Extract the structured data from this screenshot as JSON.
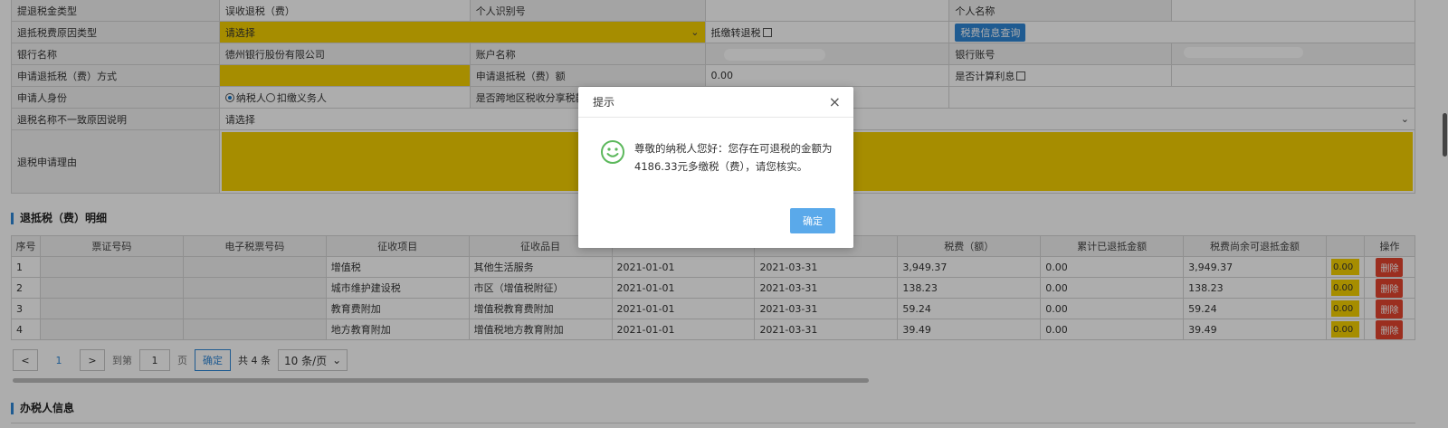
{
  "form": {
    "r1": {
      "l1": "提退税金类型",
      "v1": "误收退税（费）",
      "l2": "个人识别号",
      "l3": "个人名称"
    },
    "r2": {
      "l1": "退抵税费原因类型",
      "v1": "请选择",
      "l2": "抵缴转退税",
      "btn": "税费信息查询"
    },
    "r3": {
      "l1": "银行名称",
      "v1": "德州银行股份有限公司",
      "l2": "账户名称",
      "l3": "银行账号"
    },
    "r4": {
      "l1": "申请退抵税（费）方式",
      "l2": "申请退抵税（费）额",
      "v2": "0.00",
      "l3": "是否计算利息"
    },
    "r5": {
      "l1": "申请人身份",
      "opt1": "纳税人",
      "opt2": "扣缴义务人",
      "l2": "是否跨地区税收分享税款"
    },
    "r6": {
      "l1": "退税名称不一致原因说明",
      "v1": "请选择"
    },
    "r7": {
      "l1": "退税申请理由"
    }
  },
  "sections": {
    "detail": "退抵税（费）明细",
    "handler": "办税人信息"
  },
  "table": {
    "headers": [
      "序号",
      "票证号码",
      "电子税票号码",
      "征收项目",
      "征收品目",
      "",
      "",
      "税费（额）",
      "累计已退抵金额",
      "税费尚余可退抵金额",
      "",
      "操作"
    ],
    "rows": [
      {
        "idx": "1",
        "item": "增值税",
        "sub": "其他生活服务",
        "start": "2021-01-01",
        "end": "2021-03-31",
        "tax": "3,949.37",
        "refunded": "0.00",
        "remain": "3,949.37",
        "input": "0.00",
        "del": "删除"
      },
      {
        "idx": "2",
        "item": "城市维护建设税",
        "sub": "市区（增值税附征）",
        "start": "2021-01-01",
        "end": "2021-03-31",
        "tax": "138.23",
        "refunded": "0.00",
        "remain": "138.23",
        "input": "0.00",
        "del": "删除"
      },
      {
        "idx": "3",
        "item": "教育费附加",
        "sub": "增值税教育费附加",
        "start": "2021-01-01",
        "end": "2021-03-31",
        "tax": "59.24",
        "refunded": "0.00",
        "remain": "59.24",
        "input": "0.00",
        "del": "删除"
      },
      {
        "idx": "4",
        "item": "地方教育附加",
        "sub": "增值税地方教育附加",
        "start": "2021-01-01",
        "end": "2021-03-31",
        "tax": "39.49",
        "refunded": "0.00",
        "remain": "39.49",
        "input": "0.00",
        "del": "删除"
      }
    ]
  },
  "pager": {
    "prev": "<",
    "current": "1",
    "next": ">",
    "goto": "到第",
    "page_value": "1",
    "page_unit": "页",
    "confirm": "确定",
    "total": "共 4 条",
    "size": "10 条/页"
  },
  "dialog": {
    "title": "提示",
    "close": "×",
    "message": "尊敬的纳税人您好：您存在可退税的金额为4186.33元多缴税（费），请您核实。",
    "ok": "确定"
  },
  "colors": {
    "accent": "#2f86d6",
    "required": "#f5d000",
    "danger": "#e5452f"
  }
}
